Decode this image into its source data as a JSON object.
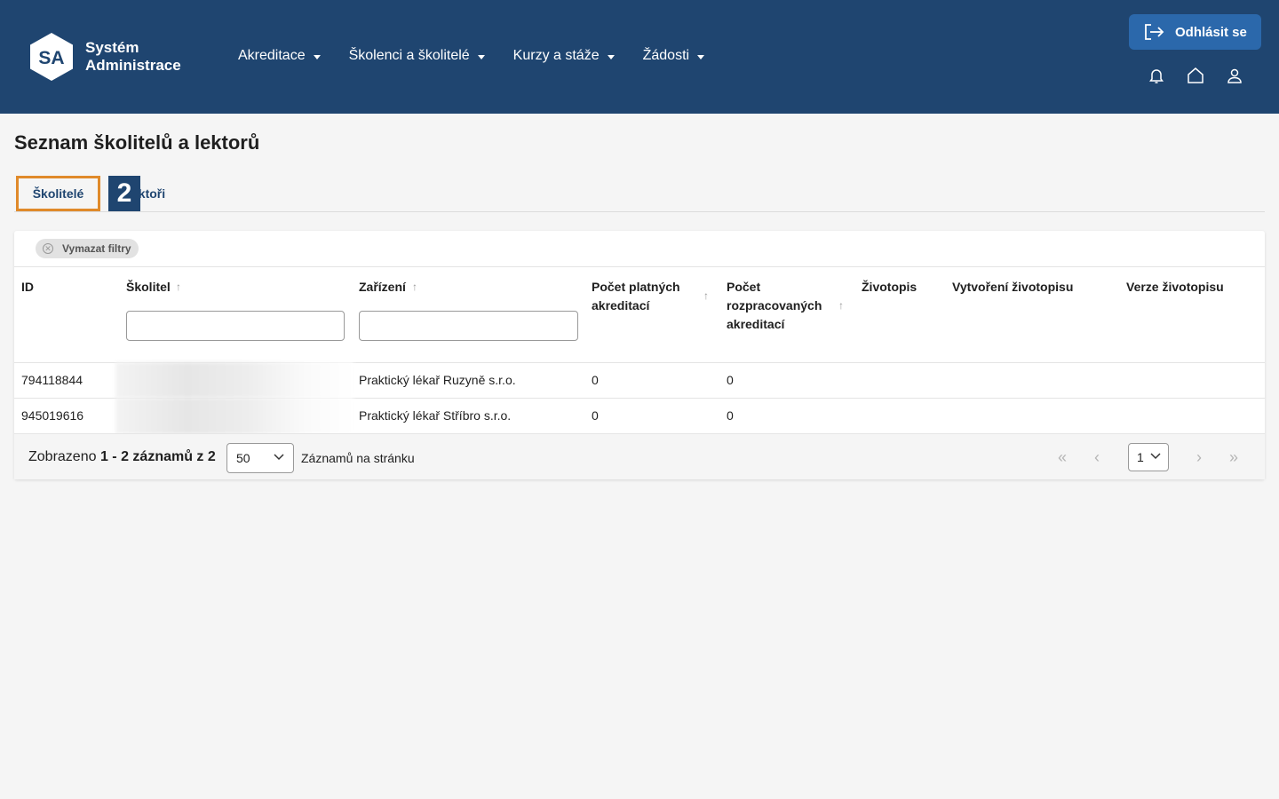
{
  "header": {
    "logo_initials": "SA",
    "logo_line1": "Systém",
    "logo_line2": "Administrace",
    "nav": [
      "Akreditace",
      "Školenci a školitelé",
      "Kurzy a stáže",
      "Žádosti"
    ],
    "logout_label": "Odhlásit se",
    "icons": [
      "bell-icon",
      "home-icon",
      "user-icon"
    ]
  },
  "page": {
    "title": "Seznam školitelů a lektorů",
    "tabs": [
      "Školitelé",
      "Lektoři"
    ],
    "second_tab_visible": "ektoři",
    "step_badge": "2"
  },
  "table": {
    "clear_filters_label": "Vymazat filtry",
    "columns": {
      "id": "ID",
      "skolitel": "Školitel",
      "zarizeni": "Zařízení",
      "platnych_1": "Počet platných",
      "platnych_2": "akreditací",
      "rozprac_1": "Počet",
      "rozprac_2": "rozpracovaných",
      "rozprac_3": "akreditací",
      "zivotopis": "Životopis",
      "vytvoreni": "Vytvoření životopisu",
      "verze": "Verze životopisu"
    },
    "rows": [
      {
        "id": "794118844",
        "zarizeni": "Praktický lékař Ruzyně s.r.o.",
        "platnych": "0",
        "rozprac": "0"
      },
      {
        "id": "945019616",
        "zarizeni": "Praktický lékař Stříbro s.r.o.",
        "platnych": "0",
        "rozprac": "0"
      }
    ]
  },
  "footer": {
    "shown_prefix": "Zobrazeno",
    "shown_range": "1 - 2 záznamů z 2",
    "page_size": "50",
    "per_page_label": "Záznamů na stránku",
    "current_page": "1"
  },
  "colors": {
    "header_bg": "#1f4570",
    "logout_bg": "#2b68ab",
    "tab_highlight": "#e08a2a"
  }
}
